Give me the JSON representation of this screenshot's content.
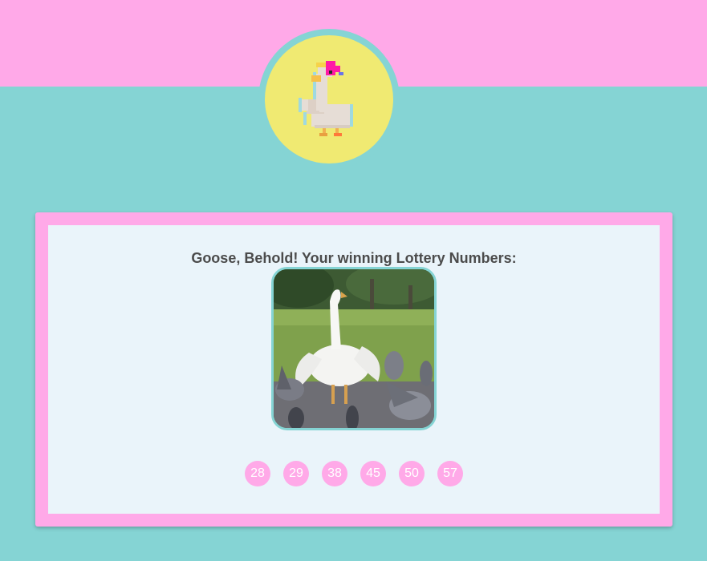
{
  "header": {
    "logo_icon": "pixel-goose-icon"
  },
  "card": {
    "title": "Goose, Behold! Your winning Lottery Numbers:",
    "image_icon": "goose-pigeons-photo",
    "numbers": [
      "28",
      "29",
      "38",
      "45",
      "50",
      "57"
    ]
  },
  "colors": {
    "background": "#85d4d4",
    "pink": "#ffa9e8",
    "logo_yellow": "#f0ea72",
    "card_inner": "#eaf4fa",
    "title_text": "#4b4b4b"
  }
}
